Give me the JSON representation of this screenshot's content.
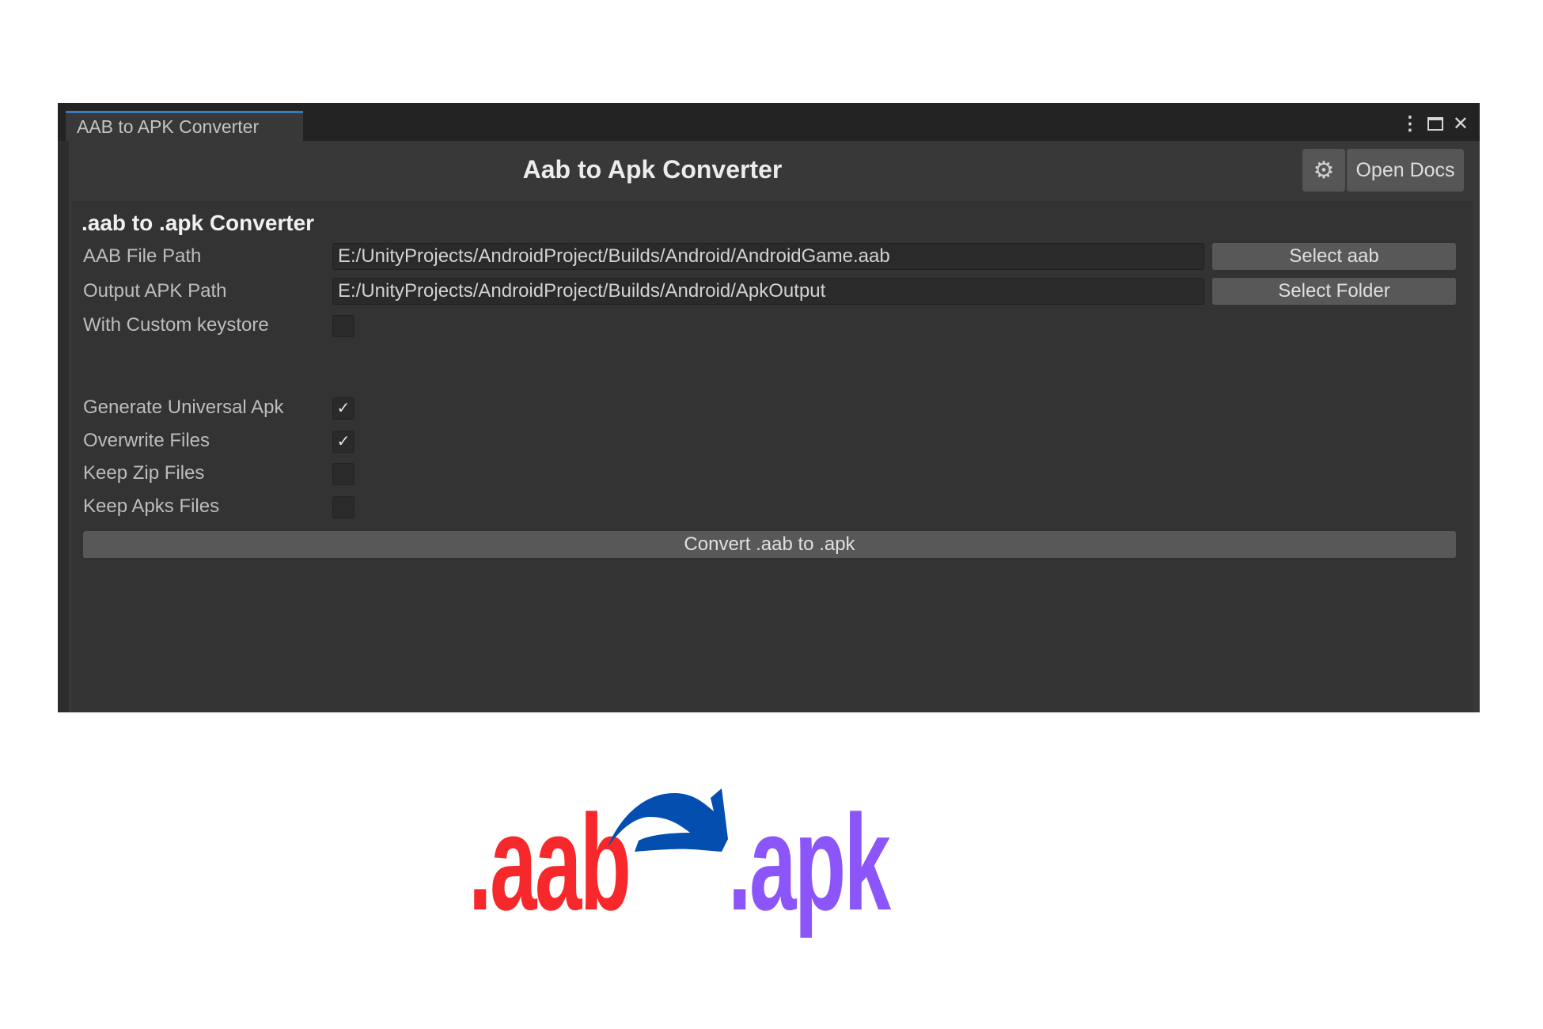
{
  "window": {
    "tab_label": "AAB to APK Converter",
    "controls": {
      "menu_icon": "kebab-menu-icon",
      "maximize_icon": "maximize-icon",
      "close_icon": "close-icon",
      "menu_glyph": "⋮",
      "close_glyph": "✕"
    }
  },
  "header": {
    "title": "Aab to Apk Converter",
    "settings_icon": "gear-icon",
    "settings_glyph": "⚙",
    "docs_label": "Open Docs"
  },
  "form": {
    "section_title": ".aab to .apk Converter",
    "aab_path": {
      "label": "AAB File Path",
      "value": "E:/UnityProjects/AndroidProject/Builds/Android/AndroidGame.aab",
      "button": "Select aab"
    },
    "output_path": {
      "label": "Output APK Path",
      "value": "E:/UnityProjects/AndroidProject/Builds/Android/ApkOutput",
      "button": "Select Folder"
    },
    "custom_keystore": {
      "label": "With Custom keystore",
      "checked": false
    },
    "options": [
      {
        "label": "Generate Universal Apk",
        "checked": true,
        "mark": "✓"
      },
      {
        "label": "Overwrite Files",
        "checked": true,
        "mark": "✓"
      },
      {
        "label": "Keep Zip Files",
        "checked": false,
        "mark": ""
      },
      {
        "label": "Keep Apks Files",
        "checked": false,
        "mark": ""
      }
    ],
    "convert_label": "Convert .aab to .apk"
  },
  "banner": {
    "from_ext": ".aab",
    "to_ext": ".apk",
    "colors": {
      "from": "#F7282B",
      "to": "#8C55FA",
      "arrow": "#034EAF"
    }
  }
}
